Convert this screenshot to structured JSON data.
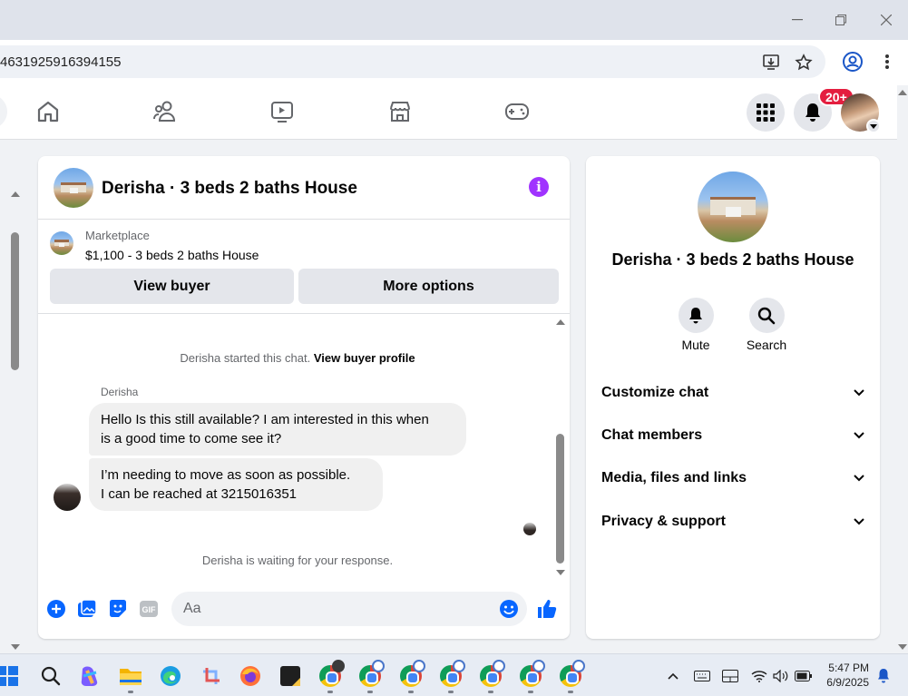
{
  "browser": {
    "url": "4631925916394155",
    "window_controls": [
      "minimize-icon",
      "restore-icon",
      "close-icon"
    ]
  },
  "fbnav": {
    "notifications_badge": "20+"
  },
  "chat": {
    "title": "Derisha · 3 beds 2 baths House",
    "marketplace_label": "Marketplace",
    "listing": "$1,100 - 3 beds 2 baths House",
    "view_buyer": "View buyer",
    "more_options": "More options",
    "started_text": "Derisha started this chat.",
    "view_profile_link": "View buyer profile",
    "sender_name": "Derisha",
    "messages": [
      {
        "line1": "Hello Is this still available? I am interested in this when",
        "line2": "is a good time to come see it?"
      },
      {
        "line1": "I’m needing to move as soon as possible.",
        "line2": "I can be reached at 3215016351"
      }
    ],
    "waiting_text": "Derisha is waiting for your response.",
    "input_placeholder": "Aa"
  },
  "right_panel": {
    "title": "Derisha · 3 beds 2 baths House",
    "mute_label": "Mute",
    "search_label": "Search",
    "sections": [
      "Customize chat",
      "Chat members",
      "Media, files and links",
      "Privacy & support"
    ]
  },
  "taskbar": {
    "time": "5:47 PM",
    "date": "6/9/2025"
  },
  "colors": {
    "accent_blue": "#0866ff",
    "badge_red": "#e41e3f",
    "info_purple": "#a033ff"
  }
}
